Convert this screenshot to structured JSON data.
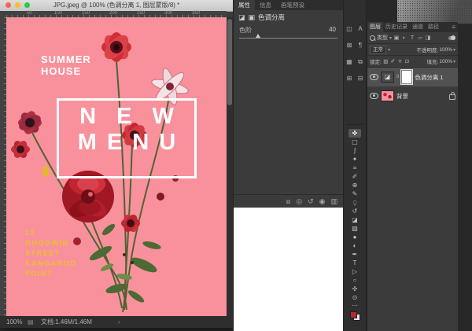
{
  "document_window": {
    "title": "JPG.jpeg @ 100% (色调分离 1, 图层蒙版/8) *",
    "ruler_numbers": [
      "50",
      "100",
      "150",
      "200",
      "250",
      "300",
      "350"
    ],
    "status": {
      "zoom": "100%",
      "status_icon": "▤",
      "doc_label": "文档:1.46M/1.46M",
      "menu_arrow": "›"
    }
  },
  "poster": {
    "title_lines": [
      "SUMMER",
      "HOUSE"
    ],
    "menu_word_top": "NEW",
    "menu_word_bottom": "MENU",
    "address_lines": [
      "15",
      "GOODWIN",
      "STREET",
      "KANGAROO",
      "POINT"
    ],
    "colors": {
      "background": "#f8919c",
      "yellow": "#f1bf2b",
      "white": "#ffffff"
    }
  },
  "properties_panel": {
    "tabs": [
      {
        "label": "属性"
      },
      {
        "label": "信息"
      },
      {
        "label": "画笔预设"
      }
    ],
    "adjustment_icon": "◪",
    "mask_icon": "▣",
    "adjustment_title": "色调分离",
    "levels_label": "色阶",
    "levels_value": "40",
    "footer_icons": [
      {
        "name": "clip-to-layer",
        "glyph": "⧈"
      },
      {
        "name": "view-previous-state",
        "glyph": "◎"
      },
      {
        "name": "reset",
        "glyph": "↺"
      },
      {
        "name": "toggle-visibility",
        "glyph": "◉"
      },
      {
        "name": "delete-adjustment",
        "glyph": "▥"
      }
    ]
  },
  "dock": {
    "panel_icons": [
      {
        "name": "adjustments-panel",
        "glyph": "◫"
      },
      {
        "name": "glyphs-panel",
        "glyph": "A"
      },
      {
        "name": "styles-panel",
        "glyph": "⊠"
      },
      {
        "name": "paragraph-panel",
        "glyph": "¶"
      },
      {
        "name": "pattern-panel",
        "glyph": "▦"
      },
      {
        "name": "libraries-panel",
        "glyph": "⧉"
      },
      {
        "name": "info-panel",
        "glyph": "⊞"
      },
      {
        "name": "histogram-panel",
        "glyph": "⊟"
      }
    ]
  },
  "toolbar": {
    "tools": [
      {
        "name": "move-tool",
        "glyph": "✜"
      },
      {
        "name": "marquee-tool",
        "glyph": "▢"
      },
      {
        "name": "lasso-tool",
        "glyph": "ʃ"
      },
      {
        "name": "magic-wand-tool",
        "glyph": "✦"
      },
      {
        "name": "crop-tool",
        "glyph": "⌗"
      },
      {
        "name": "eyedropper-tool",
        "glyph": "✐"
      },
      {
        "name": "healing-brush-tool",
        "glyph": "⊕"
      },
      {
        "name": "brush-tool",
        "glyph": "✎"
      },
      {
        "name": "clone-stamp-tool",
        "glyph": "⍜"
      },
      {
        "name": "history-brush-tool",
        "glyph": "↺"
      },
      {
        "name": "eraser-tool",
        "glyph": "◪"
      },
      {
        "name": "gradient-tool",
        "glyph": "▨"
      },
      {
        "name": "blur-tool",
        "glyph": "●"
      },
      {
        "name": "dodge-tool",
        "glyph": "◐"
      },
      {
        "name": "pen-tool",
        "glyph": "✒"
      },
      {
        "name": "type-tool",
        "glyph": "T"
      },
      {
        "name": "path-select-tool",
        "glyph": "▷"
      },
      {
        "name": "shape-tool",
        "glyph": "○"
      },
      {
        "name": "hand-tool",
        "glyph": "✣"
      },
      {
        "name": "zoom-tool",
        "glyph": "⊙"
      }
    ],
    "overflow_glyph": "⋯"
  },
  "layers_panel": {
    "tabs": [
      {
        "label": "图层"
      },
      {
        "label": "历史记录"
      },
      {
        "label": "通道"
      },
      {
        "label": "路径"
      }
    ],
    "panel_menu_icon": "≡",
    "filter_row": {
      "search_label": "类型",
      "kind_icons": [
        {
          "name": "filter-pixel-layers",
          "glyph": "▣"
        },
        {
          "name": "filter-adjustment-layers",
          "glyph": "◐"
        },
        {
          "name": "filter-type-layers",
          "glyph": "T"
        },
        {
          "name": "filter-shape-layers",
          "glyph": "▱"
        },
        {
          "name": "filter-smart-objects",
          "glyph": "◨"
        }
      ]
    },
    "blend_mode": "正常",
    "opacity_label": "不透明度:",
    "opacity_value": "100%",
    "lock_label": "锁定:",
    "lock_icons": [
      {
        "name": "lock-transparency",
        "glyph": "▨"
      },
      {
        "name": "lock-pixels",
        "glyph": "✐"
      },
      {
        "name": "lock-position",
        "glyph": "✛"
      },
      {
        "name": "lock-artboard",
        "glyph": "⊡"
      }
    ],
    "fill_label": "填充:",
    "fill_value": "100%",
    "adjustment_thumb_glyph": "◪",
    "layers": [
      {
        "name": "色调分离 1",
        "link_glyph": "8"
      },
      {
        "name": "背景"
      }
    ]
  }
}
